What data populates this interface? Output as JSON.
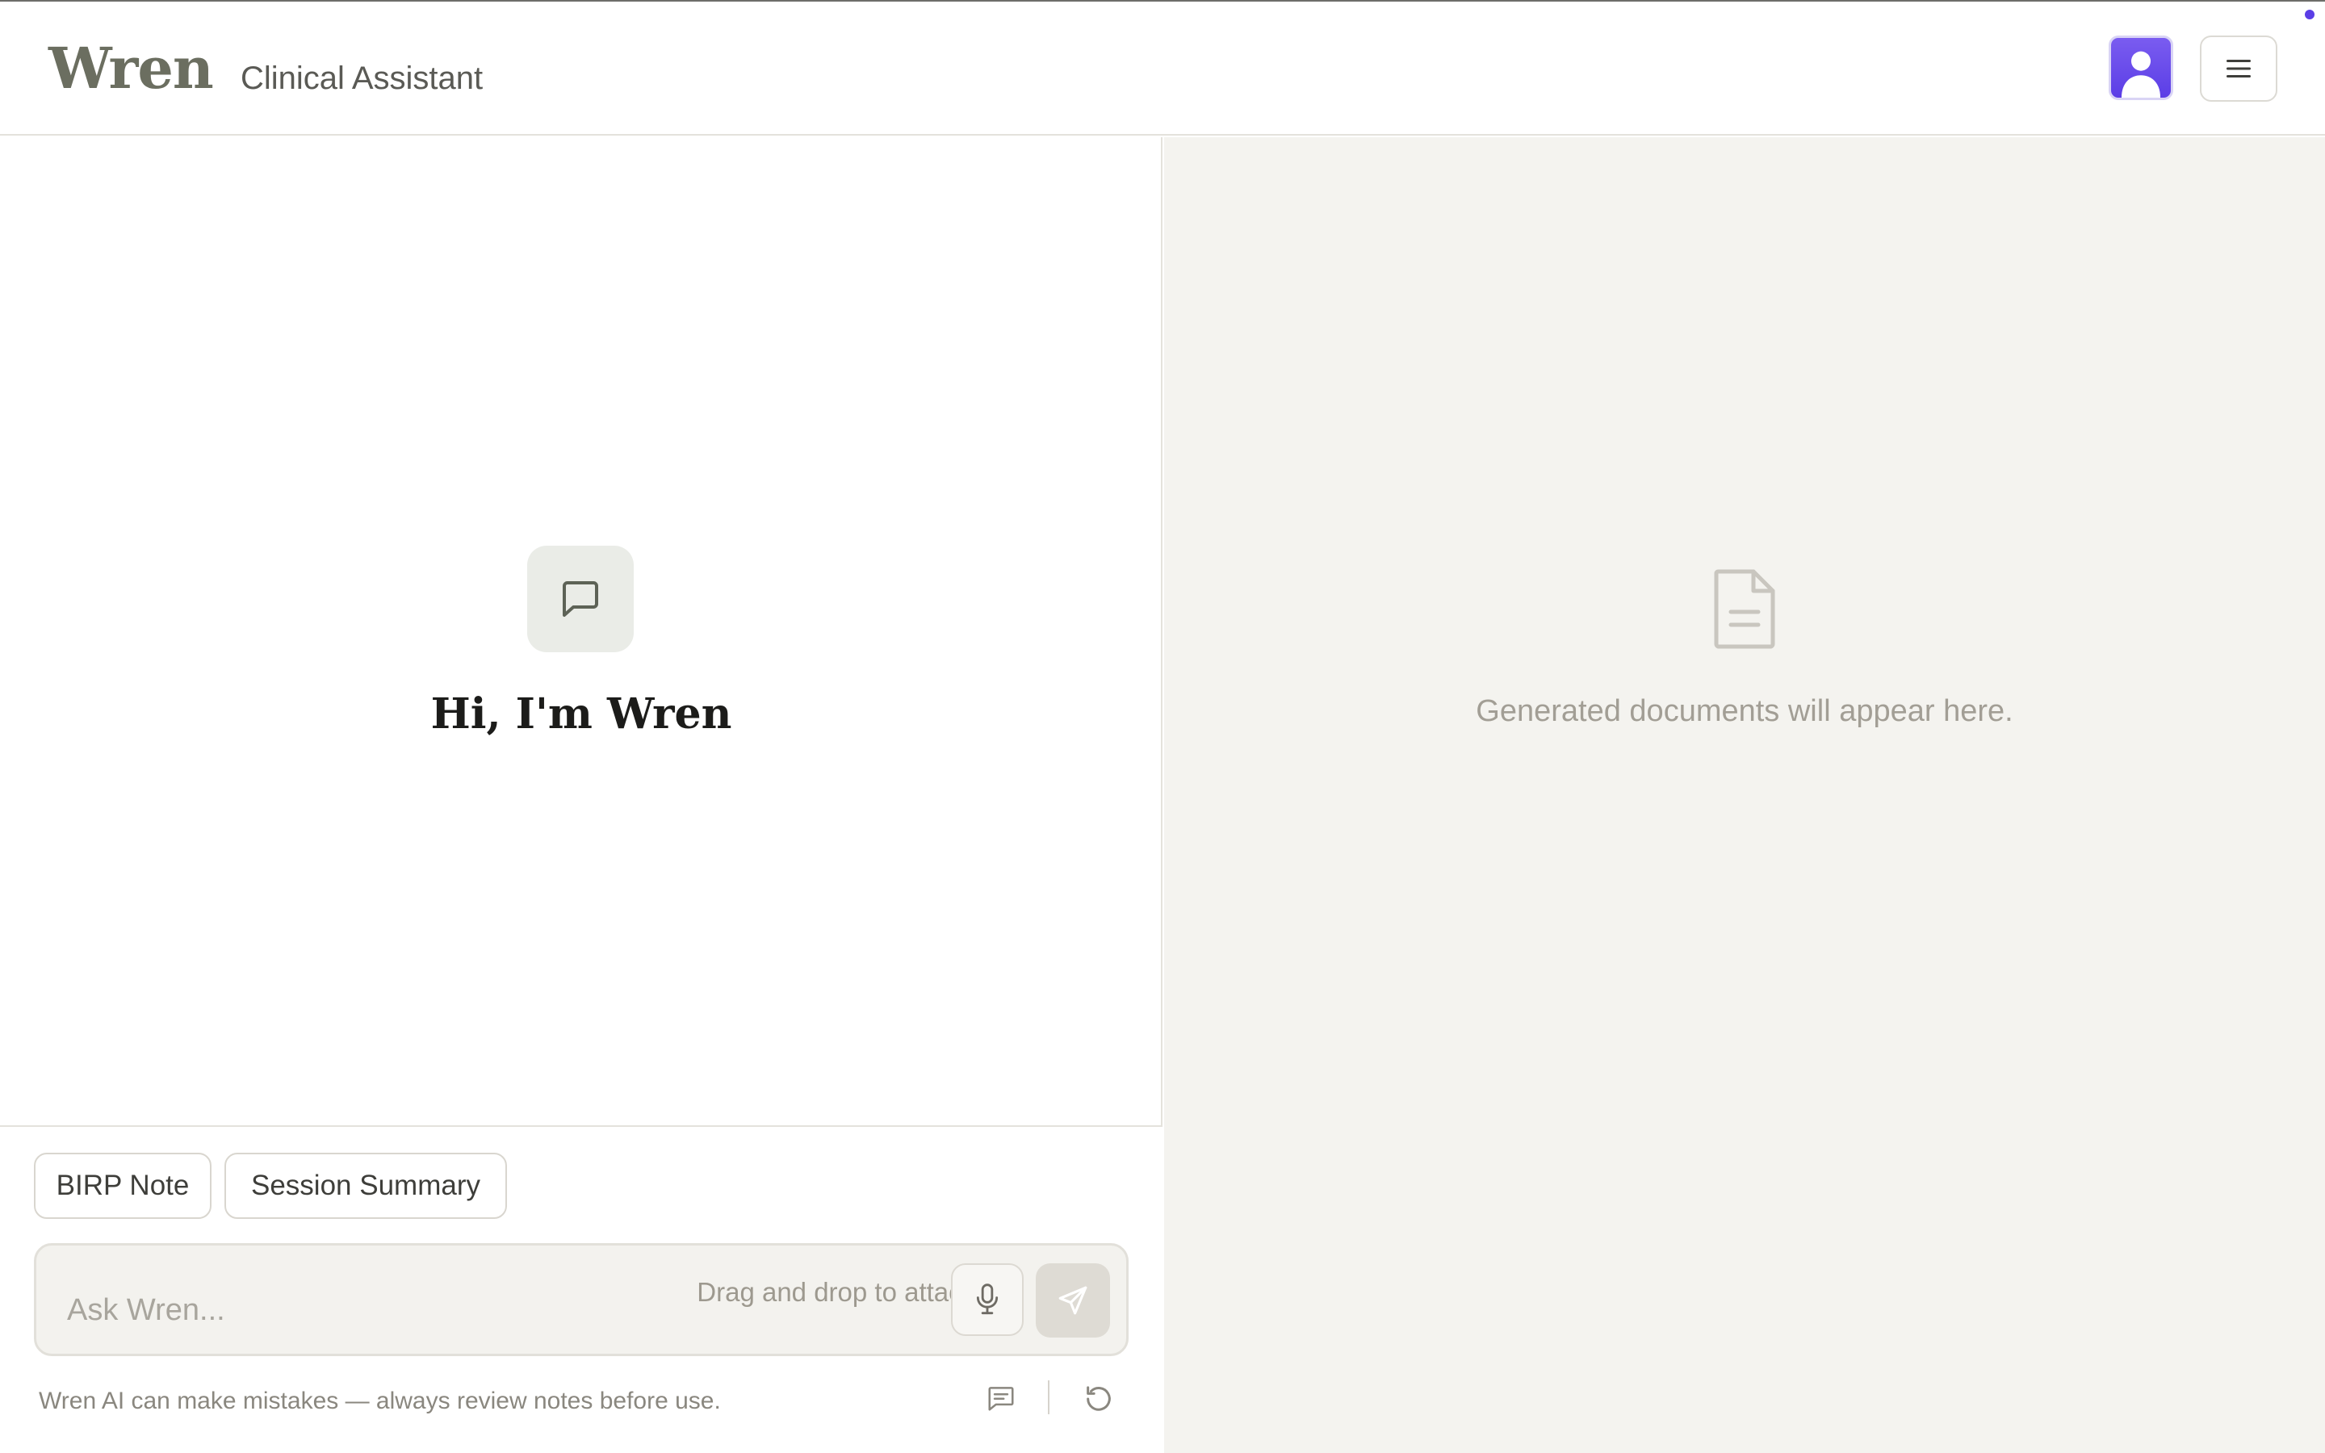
{
  "header": {
    "brand": "Wren",
    "subtitle": "Clinical Assistant",
    "avatar_icon": "user-avatar-icon",
    "menu_icon": "hamburger-menu-icon",
    "accent_color": "#5b3ee6"
  },
  "chat": {
    "empty_icon": "chat-bubble-icon",
    "greeting": "Hi, I'm Wren",
    "quick_actions": [
      {
        "label": "BIRP Note"
      },
      {
        "label": "Session Summary"
      }
    ],
    "composer": {
      "placeholder": "Ask Wren...",
      "value": "",
      "drag_hint": "Drag and drop to attach",
      "mic_icon": "microphone-icon",
      "send_icon": "send-icon"
    },
    "disclaimer": "Wren AI can make mistakes — always review notes before use.",
    "footer_icons": [
      "feedback-icon",
      "reset-icon"
    ]
  },
  "documents": {
    "empty_icon": "document-icon",
    "empty_text": "Generated documents will appear here."
  }
}
